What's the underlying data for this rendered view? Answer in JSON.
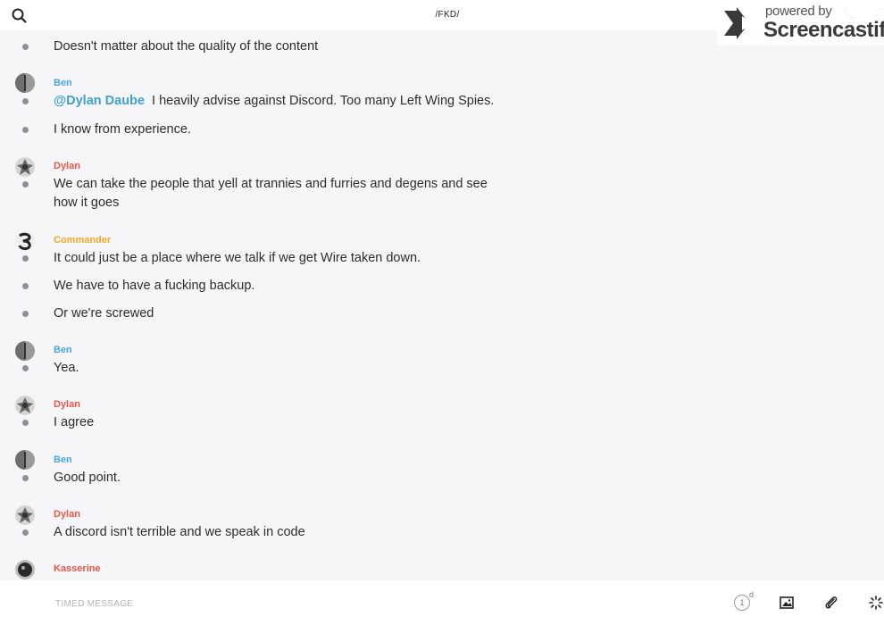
{
  "header": {
    "title": "/FKD/",
    "search_icon": "search-icon",
    "call_icon": "phone-icon",
    "info_icon": "info-icon"
  },
  "watermark": {
    "powered": "powered by",
    "brand": "Screencastify"
  },
  "colors": {
    "ben": "#4aa6d8",
    "dylan": "#e8564a",
    "commander": "#f0a92c",
    "kasserine": "#e8564a",
    "mention": "#3f9fd6",
    "bullet": "#8f8f95"
  },
  "messages": [
    {
      "text": "Doesn't matter about the quality of the content"
    },
    {
      "author": "Ben",
      "mention": "@Dylan Daube",
      "text": "I heavily advise against Discord. Too many Left Wing Spies."
    },
    {
      "text": "I know from experience."
    },
    {
      "author": "Dylan",
      "text": "We can take the people that yell at trannies and furries and degens and see how it goes"
    },
    {
      "author": "Commander",
      "text": "It could just be a place where we talk if we get Wire taken down."
    },
    {
      "text": "We have to have a fucking backup."
    },
    {
      "text": "Or we're screwed"
    },
    {
      "author": "Ben",
      "text": "Yea."
    },
    {
      "author": "Dylan",
      "text": "I agree"
    },
    {
      "author": "Ben",
      "text": "Good point."
    },
    {
      "author": "Dylan",
      "text": "A discord isn't terrible and we speak in code"
    },
    {
      "author": "Kasserine"
    }
  ],
  "composer": {
    "placeholder": "TIMED MESSAGE",
    "timer_value": "1",
    "timer_unit": "d",
    "image_icon": "image-icon",
    "attach_icon": "paperclip-icon",
    "ping_icon": "ping-icon"
  }
}
